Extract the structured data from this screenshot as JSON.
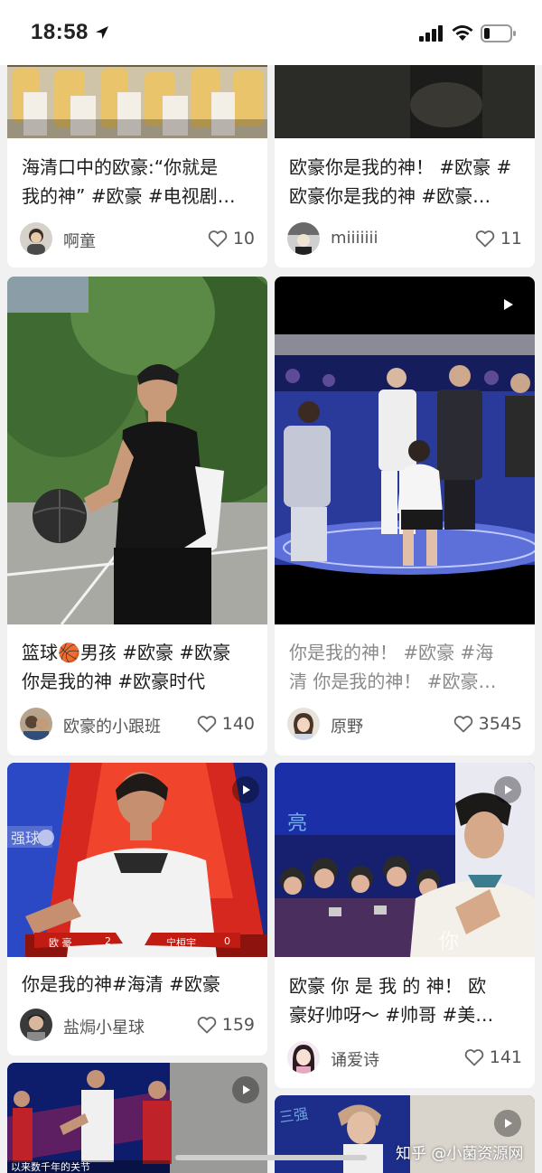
{
  "status_bar": {
    "time": "18:58"
  },
  "cards": [
    {
      "title_lines": [
        "海清口中的欧豪:“你就是",
        "我的神” #欧豪  #电视剧…"
      ],
      "user": "啊童",
      "likes": "10"
    },
    {
      "title_lines": [
        "欧豪你是我的神！ #欧豪 #",
        "欧豪你是我的神 #欧豪…"
      ],
      "user": "miiiiiii",
      "likes": "11"
    },
    {
      "title_lines": [
        "篮球🏀男孩 #欧豪 #欧豪",
        "你是我的神  #欧豪时代"
      ],
      "user": "欧豪的小跟班",
      "likes": "140"
    },
    {
      "title_lines": [
        "你是我的神！ #欧豪 #海",
        "清 你是我的神！ #欧豪…"
      ],
      "user": "原野",
      "likes": "3545"
    },
    {
      "title_lines": [
        "你是我的神#海清 #欧豪"
      ],
      "user": "盐焗小星球",
      "likes": "159",
      "overlay": {
        "left_name": "欧 豪",
        "left_score": "2",
        "right_name": "宁桓宇",
        "right_score": "0"
      }
    },
    {
      "title_lines": [
        "欧豪 你 是 我 的 神！ 欧",
        "豪好帅呀～ #帅哥  #美…"
      ],
      "user": "诵爱诗",
      "likes": "141"
    },
    {
      "caption": "以来数千年的关节"
    },
    {
      "caption": "三强"
    }
  ],
  "watermark": "知乎 @小菌资源网",
  "icons": {
    "location": "location-arrow-icon",
    "signal": "cellular-signal-icon",
    "wifi": "wifi-icon",
    "battery": "battery-icon",
    "like": "heart-outline-icon",
    "play": "play-icon"
  },
  "colors": {
    "background": "#f1f1f1",
    "card": "#ffffff",
    "text": "#1c1c1c",
    "muted": "#8a8a8a"
  }
}
